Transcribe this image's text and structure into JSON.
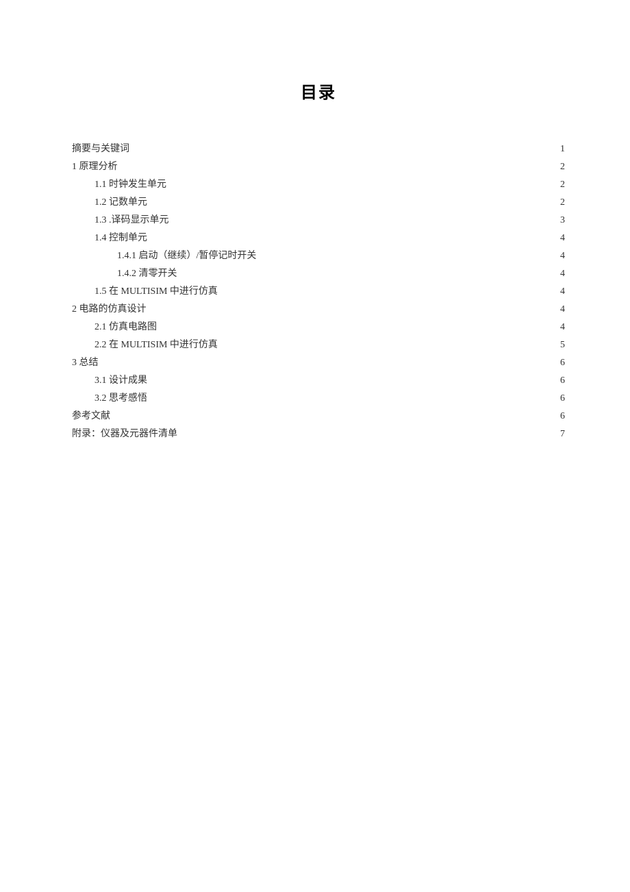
{
  "title": "目录",
  "toc": [
    {
      "label": "摘要与关键词",
      "page": "1",
      "indent": 0
    },
    {
      "label": "1 原理分析",
      "page": "2",
      "indent": 0
    },
    {
      "label": "1.1 时钟发生单元",
      "page": "2",
      "indent": 1
    },
    {
      "label": "1.2 记数单元",
      "page": "2",
      "indent": 1
    },
    {
      "label": "1.3 .译码显示单元",
      "page": "3",
      "indent": 1
    },
    {
      "label": "1.4 控制单元",
      "page": "4",
      "indent": 1
    },
    {
      "label": "1.4.1 启动（继续）/暂停记时开关",
      "page": "4",
      "indent": 2
    },
    {
      "label": "1.4.2 清零开关",
      "page": "4",
      "indent": 2
    },
    {
      "label": "1.5 在 MULTISIM 中进行仿真",
      "page": "4",
      "indent": 1
    },
    {
      "label": "2 电路的仿真设计",
      "page": "4",
      "indent": 0
    },
    {
      "label": "2.1 仿真电路图",
      "page": "4",
      "indent": 1
    },
    {
      "label": "2.2 在 MULTISIM 中进行仿真",
      "page": "5",
      "indent": 1
    },
    {
      "label": "3 总结",
      "page": "6",
      "indent": 0
    },
    {
      "label": "3.1 设计成果",
      "page": "6",
      "indent": 1
    },
    {
      "label": "3.2 思考感悟",
      "page": "6",
      "indent": 1
    },
    {
      "label": "参考文献",
      "page": "6",
      "indent": 0
    },
    {
      "label": "附录：仪器及元器件清单",
      "page": "7",
      "indent": 0
    }
  ]
}
